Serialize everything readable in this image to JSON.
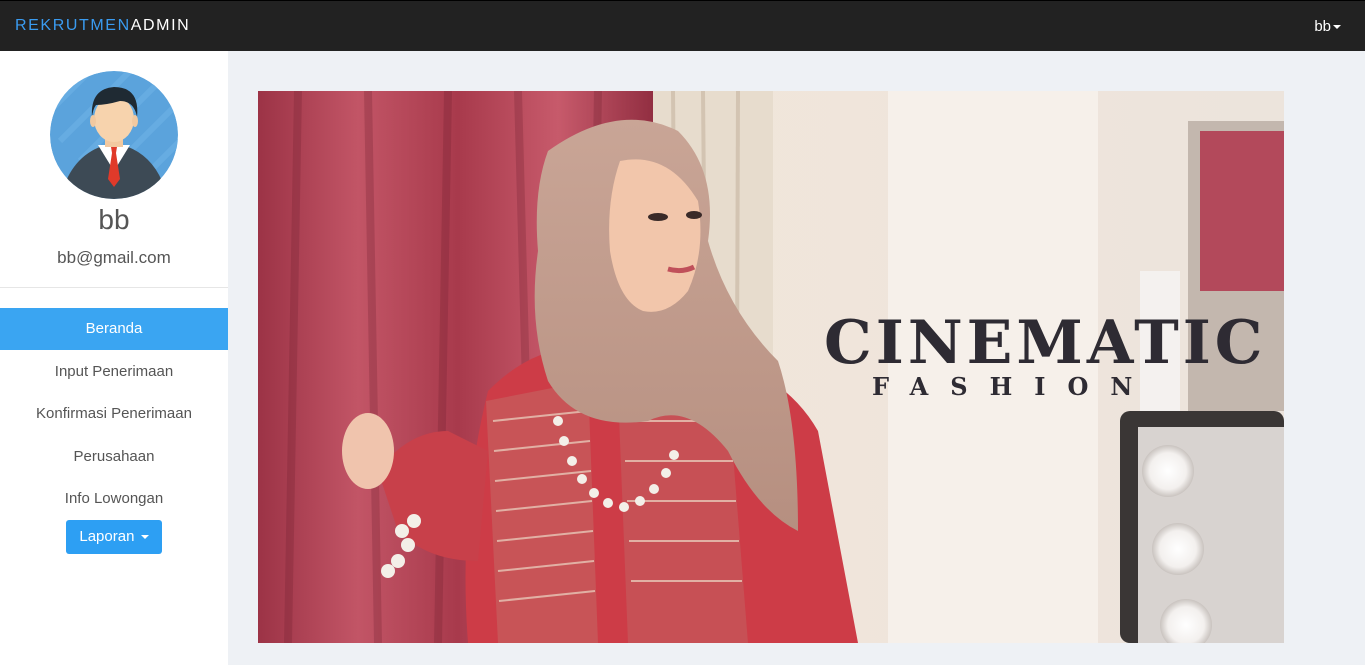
{
  "navbar": {
    "brand_part1": "REKRUTMEN",
    "brand_part2": "ADMIN",
    "user_label": "bb"
  },
  "profile": {
    "name": "bb",
    "email": "bb@gmail.com"
  },
  "sidebar": {
    "items": [
      {
        "label": "Beranda",
        "active": true
      },
      {
        "label": "Input Penerimaan"
      },
      {
        "label": "Konfirmasi Penerimaan"
      },
      {
        "label": "Perusahaan"
      },
      {
        "label": "Info Lowongan"
      }
    ],
    "laporan_label": "Laporan"
  },
  "banner": {
    "title": "CINEMATIC",
    "subtitle": "FASHION"
  },
  "colors": {
    "accent": "#3aa5f2",
    "navbar_bg": "#222222",
    "brand_blue": "#3a9bf0",
    "page_bg": "#eef1f5"
  }
}
